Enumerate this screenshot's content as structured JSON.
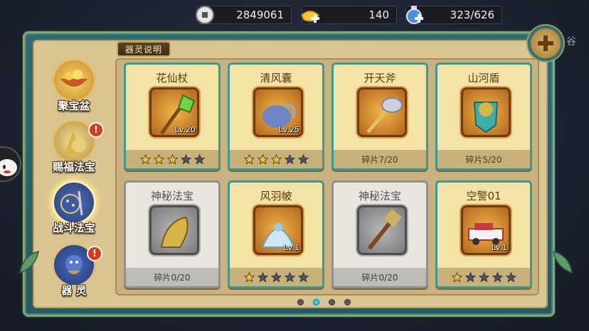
{
  "currencies": [
    {
      "id": "coin",
      "icon": "coin-icon",
      "value": "2849061"
    },
    {
      "id": "gold",
      "icon": "gold-ingot-icon",
      "value": "140"
    },
    {
      "id": "potion",
      "icon": "stamina-potion-icon",
      "value": "323/626"
    }
  ],
  "side_text": "谷",
  "info_tag": "器灵说明",
  "tabs": [
    {
      "label": "聚宝盆",
      "icon": "treasure-bowl-icon",
      "active": false,
      "badge": ""
    },
    {
      "label": "赐福法宝",
      "icon": "blessing-treasure-icon",
      "active": false,
      "badge": "!"
    },
    {
      "label": "战斗法宝",
      "icon": "battle-treasure-icon",
      "active": true,
      "badge": ""
    },
    {
      "label": "器 灵",
      "icon": "artifact-spirit-icon",
      "active": false,
      "badge": "!"
    }
  ],
  "cards": [
    {
      "name": "花仙杖",
      "icon": "flower-staff-icon",
      "locked": false,
      "level": "Lv.20",
      "stars": 3,
      "footer": ""
    },
    {
      "name": "清风囊",
      "icon": "wind-pouch-icon",
      "locked": false,
      "level": "Lv.25",
      "stars": 3,
      "footer": ""
    },
    {
      "name": "开天斧",
      "icon": "heaven-axe-icon",
      "locked": false,
      "level": "",
      "stars": 0,
      "footer": "碎片7/20"
    },
    {
      "name": "山河盾",
      "icon": "mountain-shield-icon",
      "locked": false,
      "level": "",
      "stars": 0,
      "footer": "碎片5/20"
    },
    {
      "name": "神秘法宝",
      "icon": "dragon-gauntlet-icon",
      "locked": true,
      "level": "",
      "stars": 0,
      "footer": "碎片0/20"
    },
    {
      "name": "风羽帔",
      "icon": "feather-cape-icon",
      "locked": false,
      "level": "Lv.1",
      "stars": 1,
      "footer": ""
    },
    {
      "name": "神秘法宝",
      "icon": "thunder-hammer-icon",
      "locked": true,
      "level": "",
      "stars": 0,
      "footer": "碎片0/20"
    },
    {
      "name": "空警01",
      "icon": "police-car-icon",
      "locked": false,
      "level": "Lv.1",
      "stars": 1,
      "footer": ""
    }
  ],
  "max_stars": 5,
  "pagination": {
    "pages": 4,
    "current": 2
  },
  "colors": {
    "accent_teal": "#3c9a94",
    "badge_red": "#d93a1a",
    "star_gold": "#f5c325",
    "page_dot_active": "#40c9e4"
  }
}
